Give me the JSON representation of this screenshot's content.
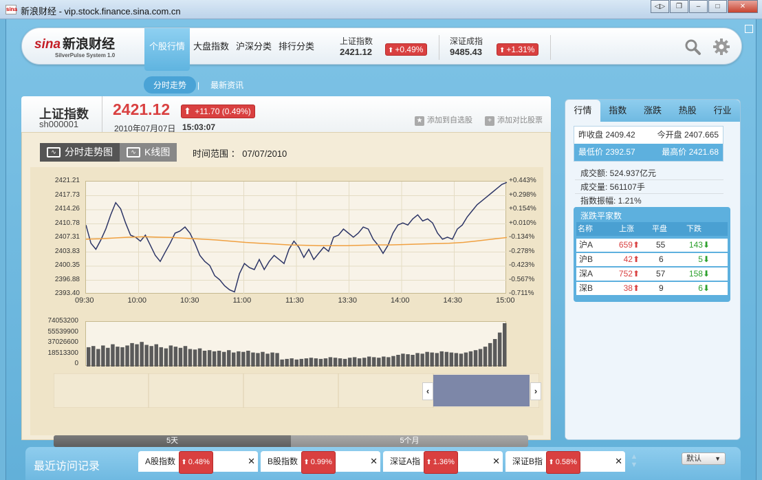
{
  "window": {
    "title": "新浪财经 - vip.stock.finance.sina.com.cn",
    "icon_label": "sina"
  },
  "header": {
    "logo_main": "sina",
    "logo_cn": "新浪财经",
    "logo_sub": "SilverPulse System 1.0",
    "nav": [
      "个股行情",
      "大盘指数",
      "沪深分类",
      "排行分类"
    ],
    "active_nav": 0,
    "sh_index": {
      "name": "上证指数",
      "value": "2421.12",
      "change": "+0.49%"
    },
    "sz_index": {
      "name": "深证成指",
      "value": "9485.43",
      "change": "+1.31%"
    },
    "icons": [
      "search-icon",
      "gear-icon"
    ]
  },
  "subtabs": [
    "分时走势",
    "最新资讯"
  ],
  "stock": {
    "name": "上证指数",
    "code": "sh000001",
    "price": "2421.12",
    "change": "+11.70 (0.49%)",
    "date": "2010年07月07日",
    "time": "15:03:07",
    "action_add_watch": "添加到自选股",
    "action_compare": "添加对比股票"
  },
  "chart_tabs": [
    "分时走势图",
    "K线图"
  ],
  "time_range_label": "时间范围 ： 07/07/2010",
  "range_buttons": [
    "5天",
    "5个月"
  ],
  "chart_data": {
    "type": "line",
    "title": "",
    "x_ticks": [
      "09:30",
      "10:00",
      "10:30",
      "11:00",
      "11:30",
      "13:30",
      "14:00",
      "14:30",
      "15:00"
    ],
    "y_ticks": [
      "2421.21",
      "2417.73",
      "2414.26",
      "2410.78",
      "2407.31",
      "2403.83",
      "2400.35",
      "2396.88",
      "2393.40"
    ],
    "y_right_ticks": [
      "+0.443%",
      "+0.298%",
      "+0.154%",
      "+0.010%",
      "-0.134%",
      "-0.278%",
      "-0.423%",
      "-0.567%",
      "-0.711%"
    ],
    "ylim": [
      2393.4,
      2421.21
    ],
    "series": [
      {
        "color": "#2c3566",
        "values": [
          2410.5,
          2406.0,
          2404.5,
          2406.8,
          2409.5,
          2413.0,
          2416.0,
          2414.5,
          2411.0,
          2408.0,
          2407.5,
          2406.5,
          2408.0,
          2405.5,
          2403.0,
          2401.5,
          2403.8,
          2406.0,
          2408.5,
          2409.0,
          2410.0,
          2408.5,
          2406.0,
          2403.0,
          2401.5,
          2400.5,
          2398.0,
          2397.0,
          2395.5,
          2394.5,
          2394.0,
          2398.5,
          2401.0,
          2400.0,
          2399.5,
          2402.0,
          2399.5,
          2401.5,
          2403.0,
          2402.0,
          2401.0,
          2404.5,
          2406.5,
          2405.0,
          2402.5,
          2404.5,
          2402.0,
          2403.5,
          2405.0,
          2404.0,
          2407.5,
          2408.0,
          2409.5,
          2408.5,
          2407.5,
          2408.5,
          2410.0,
          2409.5,
          2407.0,
          2405.5,
          2403.5,
          2405.5,
          2408.5,
          2410.5,
          2411.0,
          2410.5,
          2412.0,
          2413.0,
          2411.5,
          2412.0,
          2411.0,
          2408.5,
          2407.0,
          2407.5,
          2407.0,
          2409.5,
          2410.5,
          2412.5,
          2414.0,
          2415.5,
          2416.5,
          2417.5,
          2418.5,
          2419.5,
          2420.5,
          2421.0
        ]
      },
      {
        "color": "#f0a040",
        "values": [
          2407.0,
          2407.1,
          2407.3,
          2407.5,
          2407.6,
          2407.5,
          2407.4,
          2407.2,
          2407.0,
          2406.8,
          2406.5,
          2406.2,
          2406.0,
          2405.8,
          2405.6,
          2405.5,
          2405.4,
          2405.4,
          2405.4,
          2405.5,
          2405.6,
          2405.6,
          2405.7,
          2405.8,
          2405.9,
          2406.0,
          2406.2,
          2406.6,
          2407.0,
          2407.4
        ]
      }
    ],
    "volume": {
      "y_ticks": [
        "74053200",
        "55539900",
        "37026600",
        "18513300",
        "0"
      ],
      "ylim": [
        0,
        74053200
      ],
      "values": [
        33,
        35,
        30,
        36,
        32,
        38,
        34,
        33,
        36,
        40,
        38,
        42,
        37,
        35,
        38,
        33,
        31,
        36,
        34,
        32,
        35,
        30,
        29,
        31,
        27,
        28,
        26,
        27,
        25,
        28,
        24,
        26,
        25,
        27,
        24,
        23,
        25,
        22,
        24,
        23,
        12,
        13,
        14,
        12,
        13,
        14,
        15,
        14,
        13,
        14,
        16,
        15,
        14,
        13,
        15,
        16,
        14,
        15,
        17,
        16,
        15,
        17,
        16,
        18,
        20,
        22,
        21,
        20,
        23,
        22,
        25,
        24,
        23,
        26,
        25,
        24,
        23,
        22,
        24,
        26,
        28,
        30,
        34,
        40,
        47,
        58,
        74
      ]
    }
  },
  "right_panel": {
    "tabs": [
      "行情",
      "指数",
      "涨跌",
      "热股",
      "行业"
    ],
    "active_tab": 0,
    "prev_close": "昨收盘 2409.42",
    "open": "今开盘 2407.665",
    "low": "最低价 2392.57",
    "high": "最高价 2421.68",
    "turnover": "成交额: 524.937亿元",
    "volume": "成交量: 561107手",
    "amplitude": "指数振幅:  1.21%",
    "ad_title": "涨跌平家数",
    "ad_headers": [
      "名称",
      "上涨",
      "平盘",
      "下跌"
    ],
    "ad_rows": [
      {
        "name": "沪A",
        "up": "659",
        "flat": "55",
        "down": "143"
      },
      {
        "name": "沪B",
        "up": "42",
        "flat": "6",
        "down": "5"
      },
      {
        "name": "深A",
        "up": "752",
        "flat": "57",
        "down": "158"
      },
      {
        "name": "深B",
        "up": "38",
        "flat": "9",
        "down": "6"
      }
    ]
  },
  "bottom": {
    "title": "最近访问记录",
    "tabs": [
      {
        "label": "A股指数",
        "change": "0.48%"
      },
      {
        "label": "B股指数",
        "change": "0.99%"
      },
      {
        "label": "深证A指",
        "change": "1.36%"
      },
      {
        "label": "深证B指",
        "change": "0.58%"
      }
    ],
    "sort_label": "默认"
  }
}
